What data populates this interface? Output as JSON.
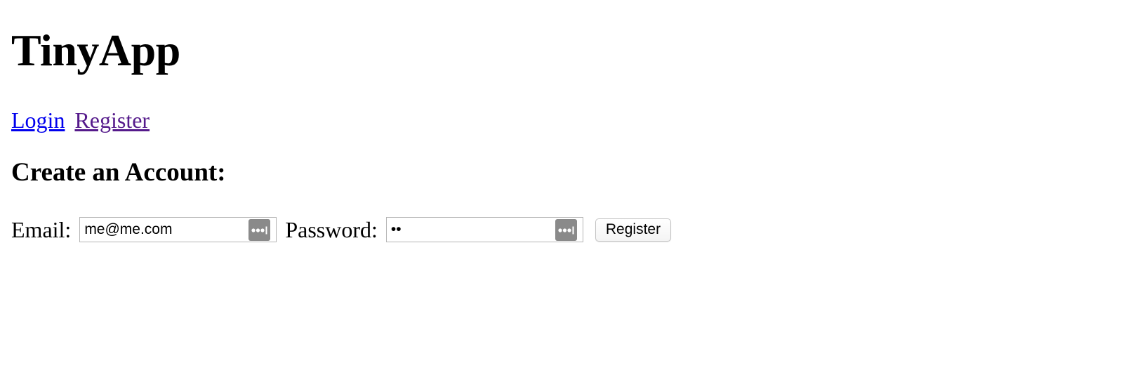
{
  "header": {
    "title": "TinyApp"
  },
  "nav": {
    "login_label": "Login",
    "register_label": "Register"
  },
  "form": {
    "heading": "Create an Account:",
    "email_label": "Email:",
    "email_value": "me@me.com",
    "password_label": "Password:",
    "password_value": "ab",
    "submit_label": "Register",
    "field_icon": "password-manager-key-icon"
  },
  "colors": {
    "link": "#0000ee",
    "visited_link": "#551a8b",
    "field_icon_bg": "#8a8a8a"
  }
}
